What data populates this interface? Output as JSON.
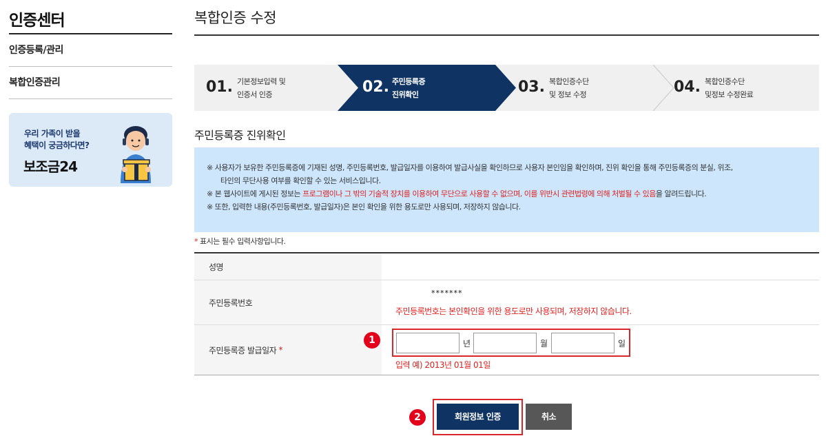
{
  "sidebar": {
    "title": "인증센터",
    "items": [
      {
        "label": "인증등록/관리"
      },
      {
        "label": "복합인증관리"
      }
    ],
    "banner": {
      "line1": "우리 가족이 받을",
      "line2": "혜택이 궁금하다면?",
      "brand": "보조금24"
    }
  },
  "main": {
    "title": "복합인증 수정",
    "steps": [
      {
        "num": "01.",
        "line1": "기본정보입력 및",
        "line2": "인증서 인증"
      },
      {
        "num": "02.",
        "line1": "주민등록증",
        "line2": "진위확인"
      },
      {
        "num": "03.",
        "line1": "복합인증수단",
        "line2": "및 정보 수정"
      },
      {
        "num": "04.",
        "line1": "복합인증수단",
        "line2": "및정보 수정완료"
      }
    ],
    "section_title": "주민등록증 진위확인",
    "notice": {
      "line1": "※ 사용자가 보유한 주민등록증에 기재된 성명, 주민등록번호, 발급일자를 이용하여 발급사실을 확인하므로 사용자 본인임을 확인하며, 진위 확인을 통해 주민등록증의 분실, 위조,",
      "line2": "타인의 무단사용 여부를 확인할 수 있는 서비스입니다.",
      "line3_pre": "※ 본 웹사이트에 게시된 정보는 ",
      "line3_red": "프로그램이나 그 밖의 기술적 장치를 이용하여 무단으로 사용할 수 없으며, 이를 위반시 관련법령에 의해 처벌될 수 있음",
      "line3_post": "을 알려드립니다.",
      "line4": "※ 또한, 입력한 내용(주민등록번호, 발급일자)은 본인 확인을 위한 용도로만 사용되며, 저장하지 않습니다."
    },
    "required_mark": "*",
    "required_note": " 표시는 필수 입력사항입니다.",
    "form": {
      "name_label": "성명",
      "name_value": "",
      "rrn_label": "주민등록번호",
      "rrn_masked": "*******",
      "rrn_warning": "주민등록번호는 본인확인을 위한 용도로만 사용되며, 저장하지 않습니다.",
      "issue_label": "주민등록증 발급일자",
      "issue_required": "*",
      "year_value": "",
      "month_value": "",
      "day_value": "",
      "year_unit": "년",
      "month_unit": "월",
      "day_unit": "일",
      "example": "입력 예) 2013년 01월 01일"
    },
    "annotations": {
      "badge1": "1",
      "badge2": "2"
    },
    "buttons": {
      "verify": "회원정보 인증",
      "cancel": "취소"
    }
  },
  "colors": {
    "active_step": "#0f3362",
    "primary_button": "#0f3362",
    "cancel_button": "#575757",
    "notice_bg": "#cde6fb",
    "highlight_red": "#e01f1f",
    "annotation_red": "#e3001b"
  }
}
